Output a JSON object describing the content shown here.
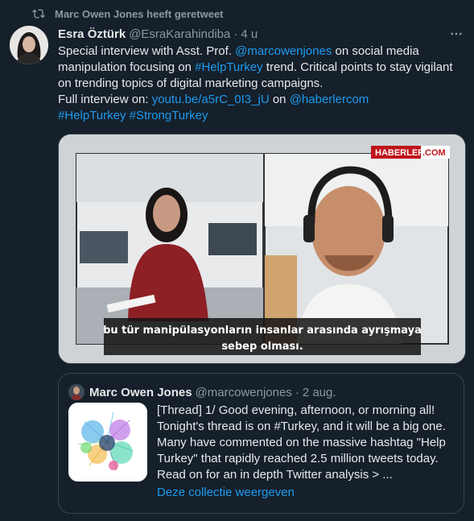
{
  "retweet": {
    "label": "Marc Owen Jones heeft geretweet"
  },
  "tweet": {
    "author_name": "Esra Öztürk",
    "author_handle": "@EsraKarahindiba",
    "separator": "·",
    "time": "4 u",
    "line1_pre": "Special interview with Asst. Prof. ",
    "mention1": "@marcowenjones",
    "line1_post": " on social media manipulation focusing on ",
    "hashtag1": "#HelpTurkey",
    "line1_end": " trend. Critical points to stay vigilant on trending topics of digital marketing campaigns.",
    "line2_pre": "Full interview on: ",
    "link": "youtu.be/a5rC_0I3_jU",
    "line2_mid": " on ",
    "mention2": "@haberlercom",
    "hashtag2": "#HelpTurkey",
    "hashtag3": "#StrongTurkey"
  },
  "media": {
    "brand_left": "HABERLER",
    "brand_right": ".COM",
    "subtitle_line1": "bu tür manipülasyonların insanlar arasında ayrışmaya",
    "subtitle_line2": "sebep olması."
  },
  "quote": {
    "author_name": "Marc Owen Jones",
    "author_handle": "@marcowenjones",
    "separator": "·",
    "date": "2 aug.",
    "text": "[Thread] 1/ Good evening, afternoon, or morning all! Tonight's thread is on #Turkey, and it will be a big one. Many have commented on the massive hashtag \"Help Turkey\" that rapidly reached 2.5 million tweets today. Read on for an in depth Twitter analysis > ...",
    "show_collection": "Deze collectie weergeven"
  },
  "colors": {
    "background": "#15202b",
    "accent": "#1d9bf0",
    "muted": "#8b98a5",
    "brand_red": "#c0141b"
  }
}
